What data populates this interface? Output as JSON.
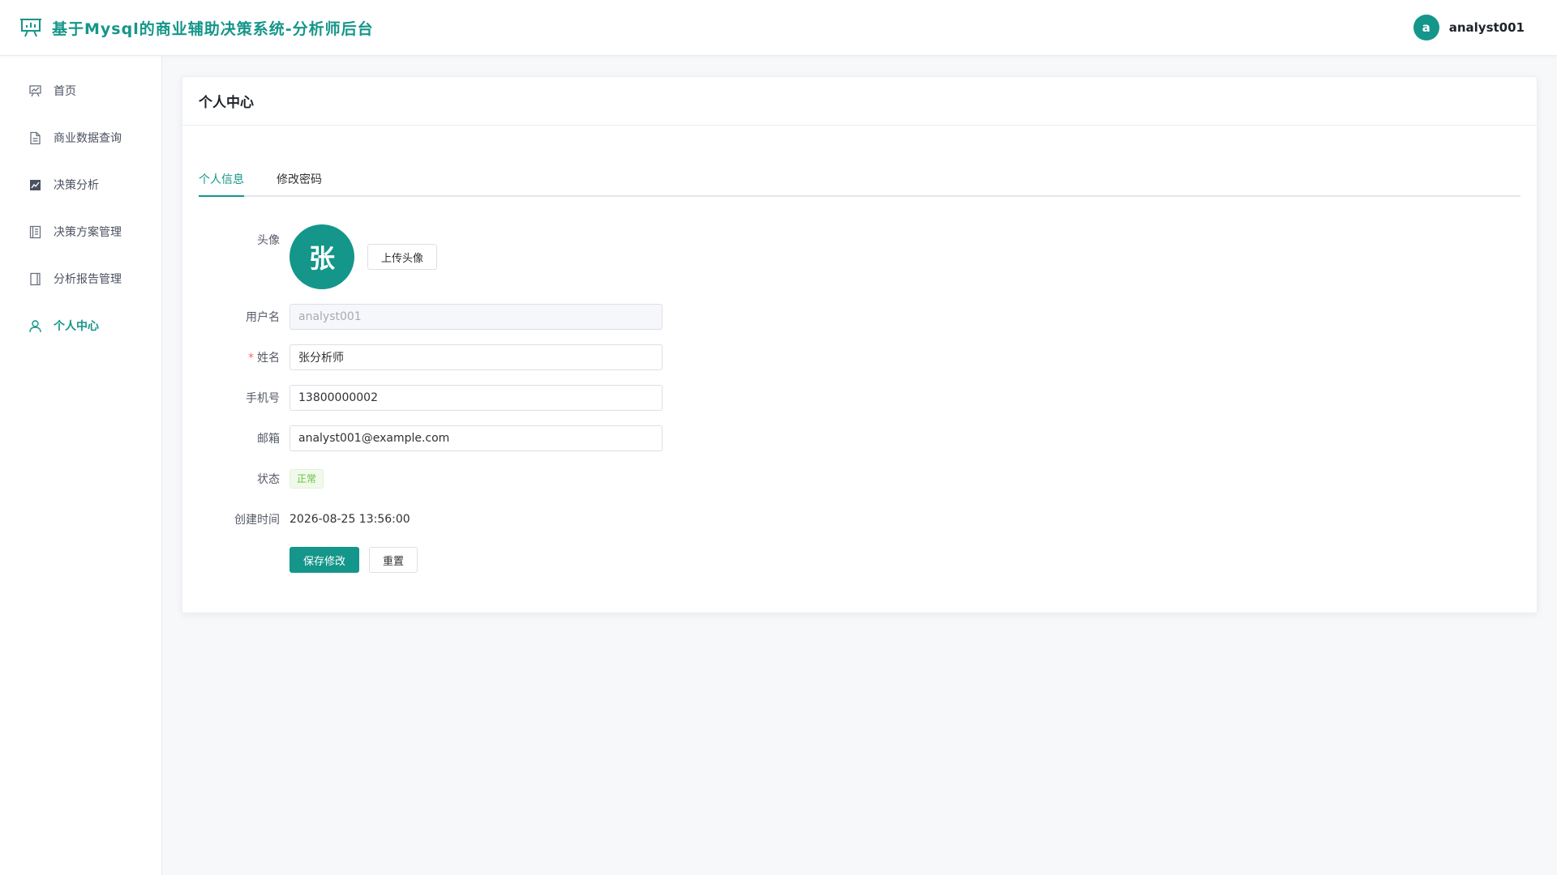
{
  "header": {
    "title": "基于Mysql的商业辅助决策系统-分析师后台",
    "logo_icon": "presentation-chart-icon",
    "user_initial": "a",
    "username": "analyst001"
  },
  "sidebar": {
    "items": [
      {
        "label": "首页",
        "icon": "chart-board-icon"
      },
      {
        "label": "商业数据查询",
        "icon": "document-icon"
      },
      {
        "label": "决策分析",
        "icon": "trend-chart-icon"
      },
      {
        "label": "决策方案管理",
        "icon": "notebook-icon"
      },
      {
        "label": "分析报告管理",
        "icon": "book-icon"
      },
      {
        "label": "个人中心",
        "icon": "user-icon",
        "active": true
      }
    ]
  },
  "page": {
    "title": "个人中心"
  },
  "tabs": [
    {
      "label": "个人信息",
      "active": true
    },
    {
      "label": "修改密码",
      "active": false
    }
  ],
  "form": {
    "avatar_label": "头像",
    "avatar_text": "张",
    "upload_button": "上传头像",
    "username_label": "用户名",
    "username_value": "analyst001",
    "required_mark": "*",
    "name_label": "姓名",
    "name_value": "张分析师",
    "phone_label": "手机号",
    "phone_value": "13800000002",
    "email_label": "邮箱",
    "email_value": "analyst001@example.com",
    "status_label": "状态",
    "status_value": "正常",
    "created_label": "创建时间",
    "created_value": "2026-08-25 13:56:00",
    "save_button": "保存修改",
    "reset_button": "重置"
  },
  "colors": {
    "accent": "#14968a",
    "status_green": "#67c23a",
    "required_red": "#f56c6c"
  }
}
